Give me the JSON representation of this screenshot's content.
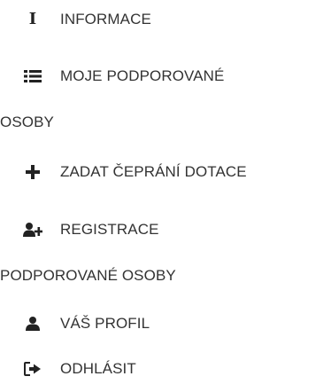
{
  "menu": {
    "items": [
      {
        "label": "INFORMACE",
        "icon": "info-icon"
      },
      {
        "label": "MOJE PODPOROVANÉ",
        "label2": "OSOBY",
        "icon": "list-icon"
      },
      {
        "label": "ZADAT ČEPRÁNÍ DOTACE",
        "icon": "plus-icon"
      },
      {
        "label": "REGISTRACE",
        "label2": "PODPOROVANÉ OSOBY",
        "icon": "user-plus-icon"
      },
      {
        "label": "VÁŠ PROFIL",
        "icon": "user-icon"
      },
      {
        "label": "ODHLÁSIT",
        "icon": "sign-out-icon"
      }
    ]
  },
  "colors": {
    "text": "#333333",
    "icon": "#222222",
    "background": "#ffffff"
  }
}
